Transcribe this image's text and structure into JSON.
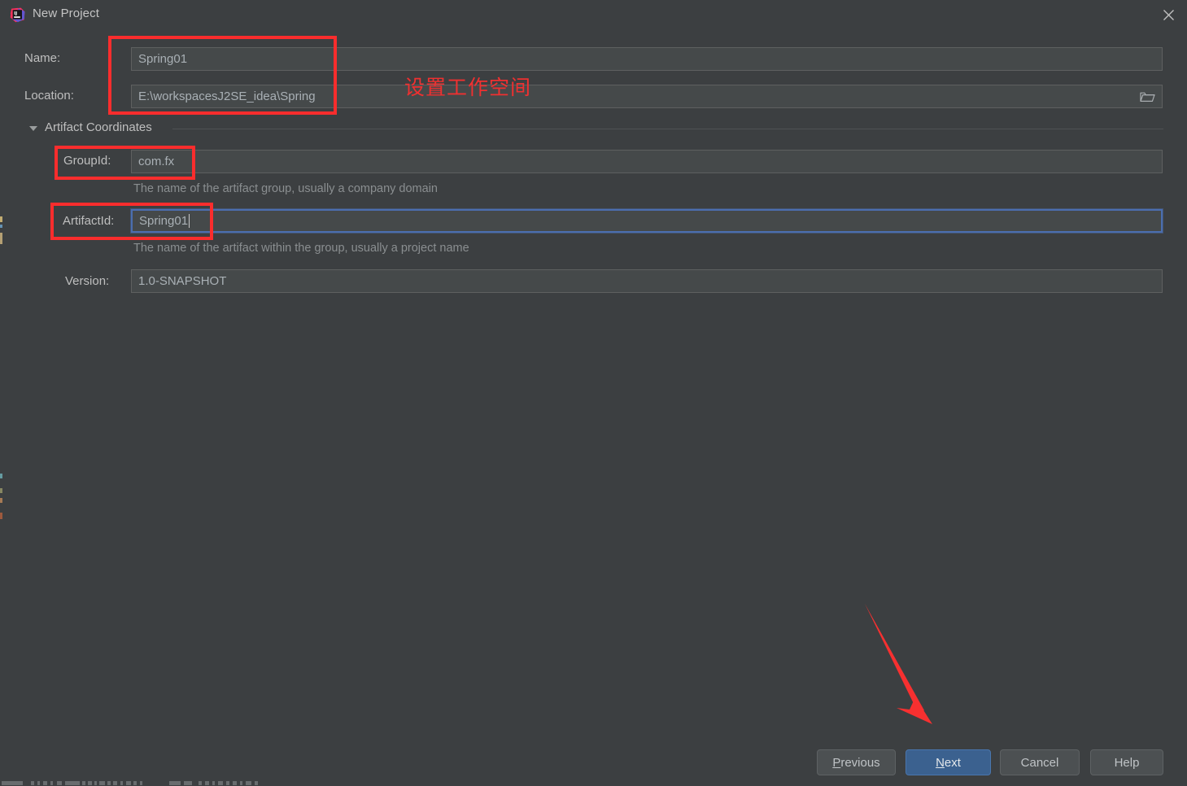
{
  "window": {
    "title": "New Project",
    "app_icon": "intellij-idea-icon",
    "close_icon": "close-icon"
  },
  "form": {
    "name": {
      "label": "Name:",
      "value": "Spring01"
    },
    "location": {
      "label": "Location:",
      "value": "E:\\workspacesJ2SE_idea\\Spring",
      "browse_icon": "folder-browse-icon"
    },
    "artifact_section": {
      "label": "Artifact Coordinates",
      "expanded": true,
      "toggle_icon": "chevron-down-icon"
    },
    "group_id": {
      "label": "GroupId:",
      "value": "com.fx",
      "hint": "The name of the artifact group, usually a company domain"
    },
    "artifact_id": {
      "label": "ArtifactId:",
      "value": "Spring01",
      "hint": "The name of the artifact within the group, usually a project name",
      "focused": true
    },
    "version": {
      "label": "Version:",
      "value": "1.0-SNAPSHOT"
    }
  },
  "buttons": {
    "previous": {
      "label": "Previous",
      "mnemonic": "P"
    },
    "next": {
      "label": "Next",
      "mnemonic": "N",
      "primary": true
    },
    "cancel": {
      "label": "Cancel"
    },
    "help": {
      "label": "Help"
    }
  },
  "annotations": {
    "note_text": "设置工作空间",
    "highlight_color": "#fa2d2d",
    "boxes": [
      {
        "name": "name-location-highlight"
      },
      {
        "name": "groupid-highlight"
      },
      {
        "name": "artifactid-highlight"
      }
    ],
    "arrow": {
      "name": "next-button-arrow"
    }
  },
  "theme": {
    "window_bg": "#3c3f41",
    "input_bg": "#45494a",
    "accent_blue": "#4b6eaf",
    "primary_button": "#3b618f",
    "text": "#bfbfbf",
    "hint_text": "#8a8e90"
  }
}
